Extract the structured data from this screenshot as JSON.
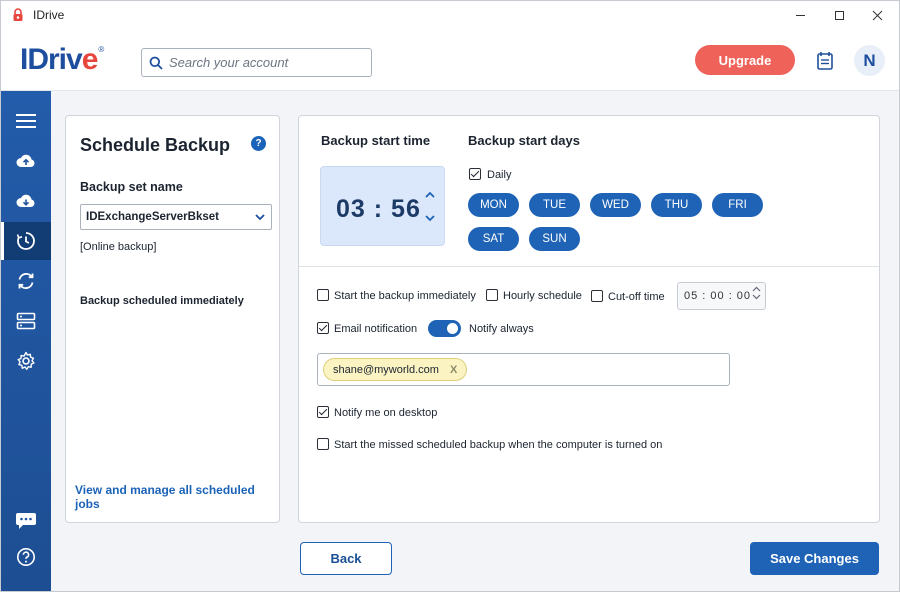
{
  "window": {
    "title": "IDrive",
    "controls": [
      "minimize",
      "maximize",
      "close"
    ]
  },
  "header": {
    "logo_text": "IDrive",
    "search_placeholder": "Search your account",
    "upgrade_label": "Upgrade",
    "avatar_initial": "N",
    "icons": [
      "search-icon",
      "calendar-icon"
    ]
  },
  "sidebar": {
    "items": [
      {
        "icon": "menu-icon"
      },
      {
        "icon": "cloud-upload-icon"
      },
      {
        "icon": "cloud-download-icon"
      },
      {
        "icon": "schedule-clock-icon",
        "active": true
      },
      {
        "icon": "sync-icon"
      },
      {
        "icon": "server-icon"
      },
      {
        "icon": "settings-gear-icon"
      },
      {
        "icon": "chat-icon"
      },
      {
        "icon": "help-icon"
      }
    ]
  },
  "left_panel": {
    "title": "Schedule Backup",
    "help_glyph": "?",
    "backup_set_label": "Backup set name",
    "backup_set_value": "IDExchangeServerBkset",
    "backup_type": "[Online backup]",
    "status": "Backup scheduled immediately",
    "manage_link": "View and manage all scheduled jobs"
  },
  "schedule": {
    "start_time_label": "Backup start time",
    "time_hours": "03",
    "time_sep": ":",
    "time_minutes": "56",
    "start_days_label": "Backup start days",
    "daily_label": "Daily",
    "daily_checked": true,
    "days": [
      "MON",
      "TUE",
      "WED",
      "THU",
      "FRI",
      "SAT",
      "SUN"
    ]
  },
  "options": {
    "start_immediately_label": "Start the backup immediately",
    "start_immediately_checked": false,
    "hourly_label": "Hourly schedule",
    "hourly_checked": false,
    "cutoff_label": "Cut-off time",
    "cutoff_checked": false,
    "cutoff_value": "05 : 00 : 00",
    "email_label": "Email notification",
    "email_checked": true,
    "notify_always_label": "Notify always",
    "notify_always_on": true,
    "email_chip": "shane@myworld.com",
    "email_chip_remove": "X",
    "desktop_label": "Notify me on desktop",
    "desktop_checked": true,
    "missed_label": "Start the missed scheduled backup when the computer is turned on",
    "missed_checked": false
  },
  "footer": {
    "back_label": "Back",
    "save_label": "Save Changes"
  },
  "colors": {
    "accent": "#1e63b6",
    "upgrade": "#ee625a",
    "sidebar": "#1d4e93",
    "time_box": "#dbe7fa",
    "chip": "#fbf3c2"
  }
}
